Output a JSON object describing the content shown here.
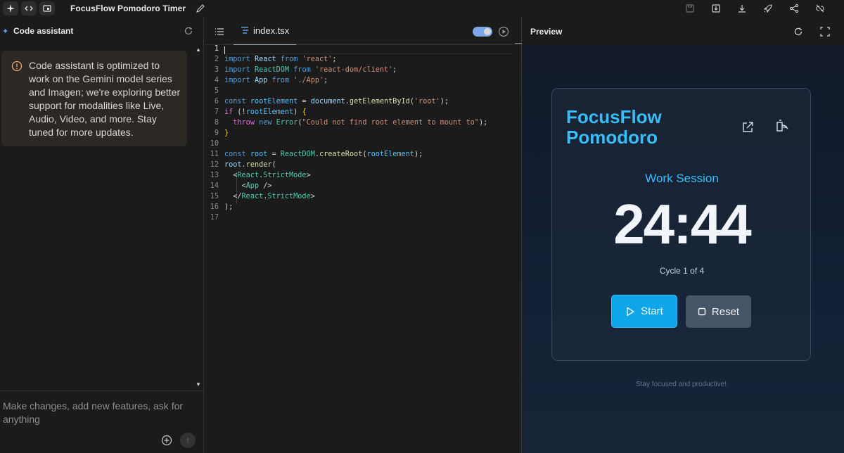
{
  "app": {
    "title": "FocusFlow Pomodoro Timer"
  },
  "assistant": {
    "title": "Code assistant",
    "notice": "Code assistant is optimized to work on the Gemini model series and Imagen; we're exploring better support for modalities like Live, Audio, Video, and more. Stay tuned for more updates.",
    "prompt_placeholder": "Make changes, add new features, ask for anything"
  },
  "editor": {
    "tab_label": "index.tsx",
    "line_numbers": [
      "1",
      "2",
      "3",
      "4",
      "5",
      "6",
      "7",
      "8",
      "9",
      "10",
      "11",
      "12",
      "13",
      "14",
      "15",
      "16",
      "17"
    ]
  },
  "preview": {
    "title": "Preview",
    "app_title": "FocusFlow Pomodoro",
    "session_label": "Work Session",
    "timer": "24:44",
    "cycle": "Cycle 1 of 4",
    "start_label": "Start",
    "reset_label": "Reset",
    "footer": "Stay focused and productive!",
    "colors": {
      "accent": "#38bdf8",
      "start_bg": "#0ea5e9",
      "reset_bg": "#475569"
    }
  },
  "icons": {
    "topbar": [
      "sparkle-icon",
      "code-icon",
      "layout-icon",
      "pencil-icon"
    ],
    "topbar_right": [
      "save-icon",
      "download-app-icon",
      "download-icon",
      "deploy-rocket-icon",
      "share-icon",
      "link-off-icon"
    ]
  }
}
